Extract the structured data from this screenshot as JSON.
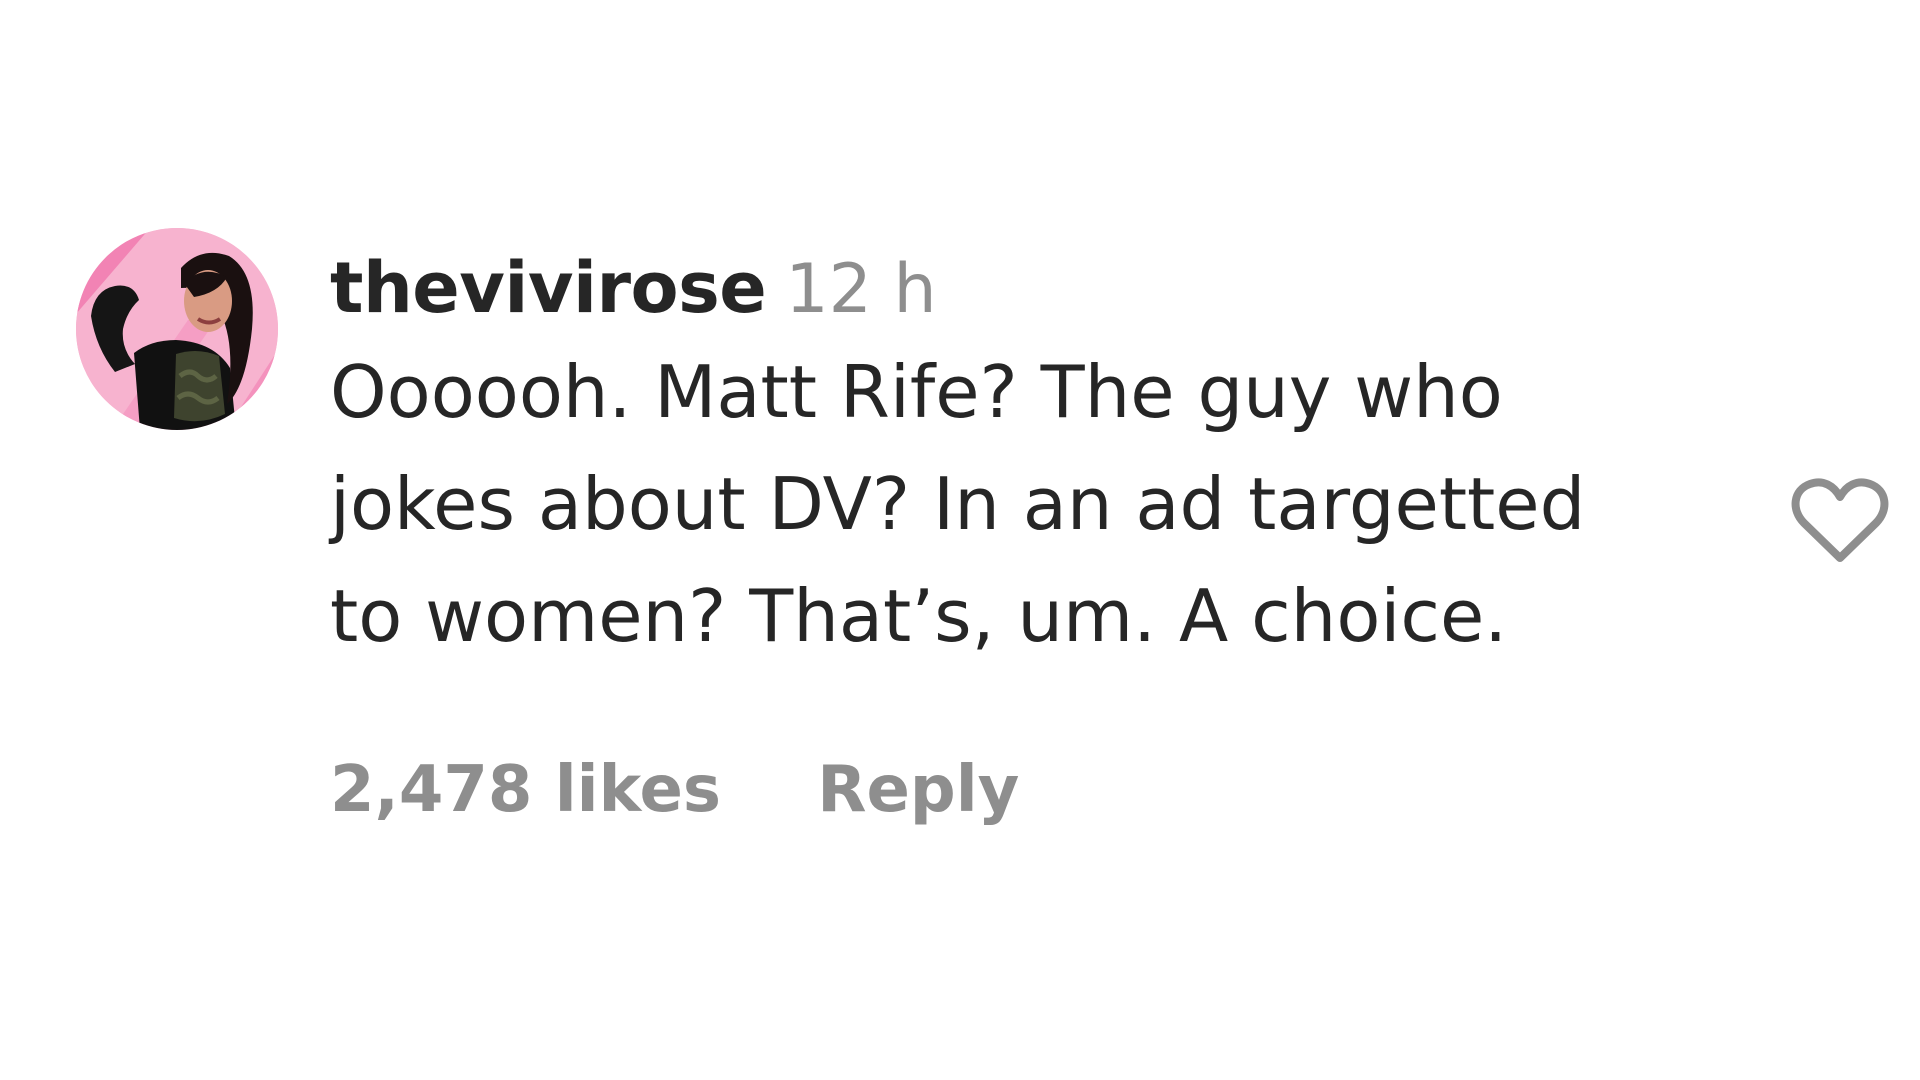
{
  "comment": {
    "username": "thevivirose",
    "timestamp": "12 h",
    "text_lines": [
      "Oooooh. Matt Rife? The guy who",
      "jokes about DV? In an ad targetted",
      "to women? That’s, um. A choice."
    ],
    "likes": "2,478 likes",
    "reply_label": "Reply",
    "like_icon": "heart-outline-icon",
    "avatar_icon": "profile-avatar"
  },
  "colors": {
    "text": "#262626",
    "muted": "#8e8e8e",
    "avatar_bg": "#f7b3cf",
    "icon": "#8e8e8e"
  }
}
